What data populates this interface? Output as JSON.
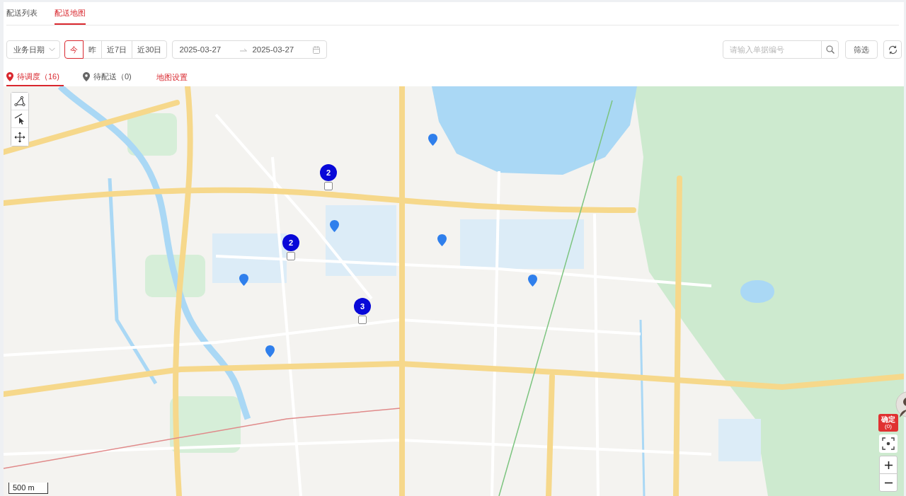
{
  "tabs": [
    {
      "label": "配送列表",
      "selected": false
    },
    {
      "label": "配送地图",
      "selected": true
    }
  ],
  "filters": {
    "date_type": "业务日期",
    "quick_dates": [
      {
        "label": "今",
        "selected": true
      },
      {
        "label": "昨",
        "selected": false
      },
      {
        "label": "近7日",
        "selected": false
      },
      {
        "label": "近30日",
        "selected": false
      }
    ],
    "date_range": {
      "start": "2025-03-27",
      "end": "2025-03-27"
    },
    "search": {
      "placeholder": "请输入单据编号"
    },
    "filter_button": "筛选"
  },
  "status_tabs": [
    {
      "label": "待调度（16)",
      "selected": true
    },
    {
      "label": "待配送（0)",
      "selected": false
    }
  ],
  "map_settings_link": "地图设置",
  "map": {
    "markers": [
      {
        "kind": "pin"
      },
      {
        "kind": "cluster",
        "count": "2",
        "checked": false
      },
      {
        "kind": "pin"
      },
      {
        "kind": "pin"
      },
      {
        "kind": "cluster",
        "count": "2",
        "checked": false
      },
      {
        "kind": "pin"
      },
      {
        "kind": "pin"
      },
      {
        "kind": "cluster",
        "count": "3",
        "checked": false
      },
      {
        "kind": "pin"
      }
    ],
    "confirm_button": {
      "label": "确定",
      "count": "(0)"
    },
    "scale": "500 m"
  }
}
